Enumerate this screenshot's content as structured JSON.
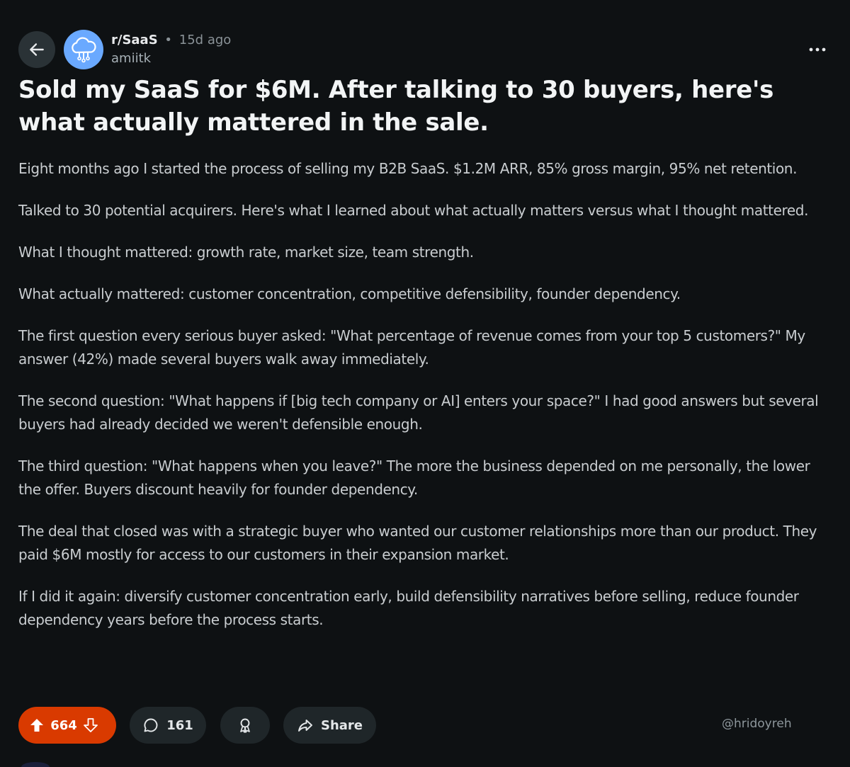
{
  "header": {
    "subreddit": "r/SaaS",
    "separator": "•",
    "time_ago": "15d ago",
    "author": "amiitk",
    "icons": {
      "back": "arrow-left-icon",
      "avatar": "cloud-network-icon",
      "more": "more-horizontal-icon"
    }
  },
  "post": {
    "title": "Sold my SaaS for $6M. After talking to 30 buyers, here's what actually mattered in the sale.",
    "paragraphs": [
      "Eight months ago I started the process of selling my B2B SaaS. $1.2M ARR, 85% gross margin, 95% net retention.",
      "Talked to 30 potential acquirers. Here's what I learned about what actually matters versus what I thought mattered.",
      "What I thought mattered: growth rate, market size, team strength.",
      "What actually mattered: customer concentration, competitive defensibility, founder dependency.",
      "The first question every serious buyer asked: \"What percentage of revenue comes from your top 5 customers?\" My answer (42%) made several buyers walk away immediately.",
      "The second question: \"What happens if [big tech company or AI] enters your space?\" I had good answers but several buyers had already decided we weren't defensible enough.",
      "The third question: \"What happens when you leave?\" The more the business depended on me personally, the lower the offer. Buyers discount heavily for founder dependency.",
      "The deal that closed was with a strategic buyer who wanted our customer relationships more than our product. They paid $6M mostly for access to our customers in their expansion market.",
      "If I did it again: diversify customer concentration early, build defensibility narratives before selling, reduce founder dependency years before the process starts."
    ]
  },
  "actions": {
    "votes": "664",
    "comments": "161",
    "share_label": "Share",
    "icons": {
      "upvote": "upvote-arrow-icon",
      "downvote": "downvote-arrow-icon",
      "comment": "comment-bubble-icon",
      "award": "award-icon",
      "share": "share-arrow-icon"
    }
  },
  "watermark": "@hridoyreh",
  "colors": {
    "background": "#0e1113",
    "vote_active": "#d93a00",
    "pill": "#1f2629",
    "avatar": "#6aa9ff"
  }
}
